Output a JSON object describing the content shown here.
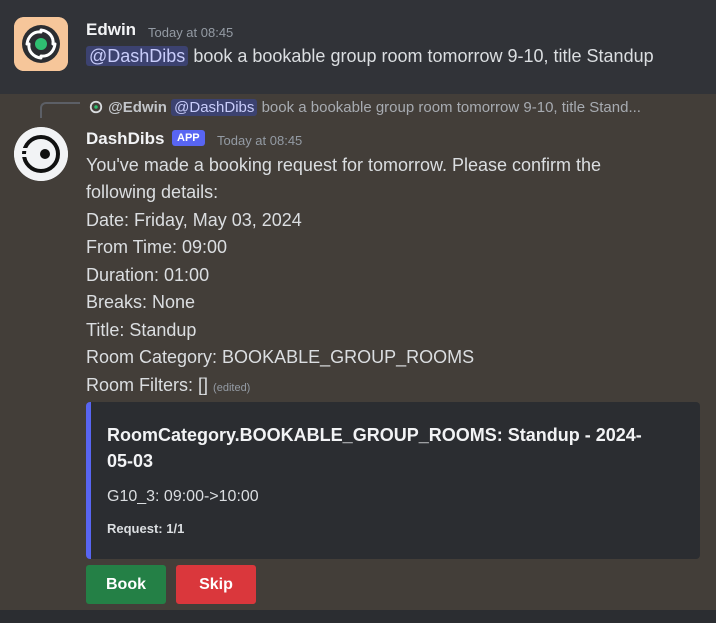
{
  "message1": {
    "author": "Edwin",
    "timestamp": "Today at 08:45",
    "mention": "@DashDibs",
    "text": "book a bookable group room tomorrow 9-10, title Standup"
  },
  "reply": {
    "author": "@Edwin",
    "mention": "@DashDibs",
    "text": "book a bookable group room tomorrow 9-10, title Stand..."
  },
  "message2": {
    "author": "DashDibs",
    "badge": "APP",
    "timestamp": "Today at 08:45",
    "lines": [
      "You've made a booking request for tomorrow. Please confirm the",
      "following details:",
      "Date: Friday, May 03, 2024",
      "From Time: 09:00",
      "Duration: 01:00",
      "Breaks: None",
      "Title: Standup",
      "Room Category: BOOKABLE_GROUP_ROOMS",
      "Room Filters: []"
    ],
    "edited": "(edited)"
  },
  "embed": {
    "title_line1": "RoomCategory.BOOKABLE_GROUP_ROOMS: Standup - 2024-",
    "title_line2": "05-03",
    "description": "G10_3: 09:00->10:00",
    "footer": "Request: 1/1",
    "accent": "#5865f2"
  },
  "buttons": {
    "book": "Book",
    "skip": "Skip"
  }
}
